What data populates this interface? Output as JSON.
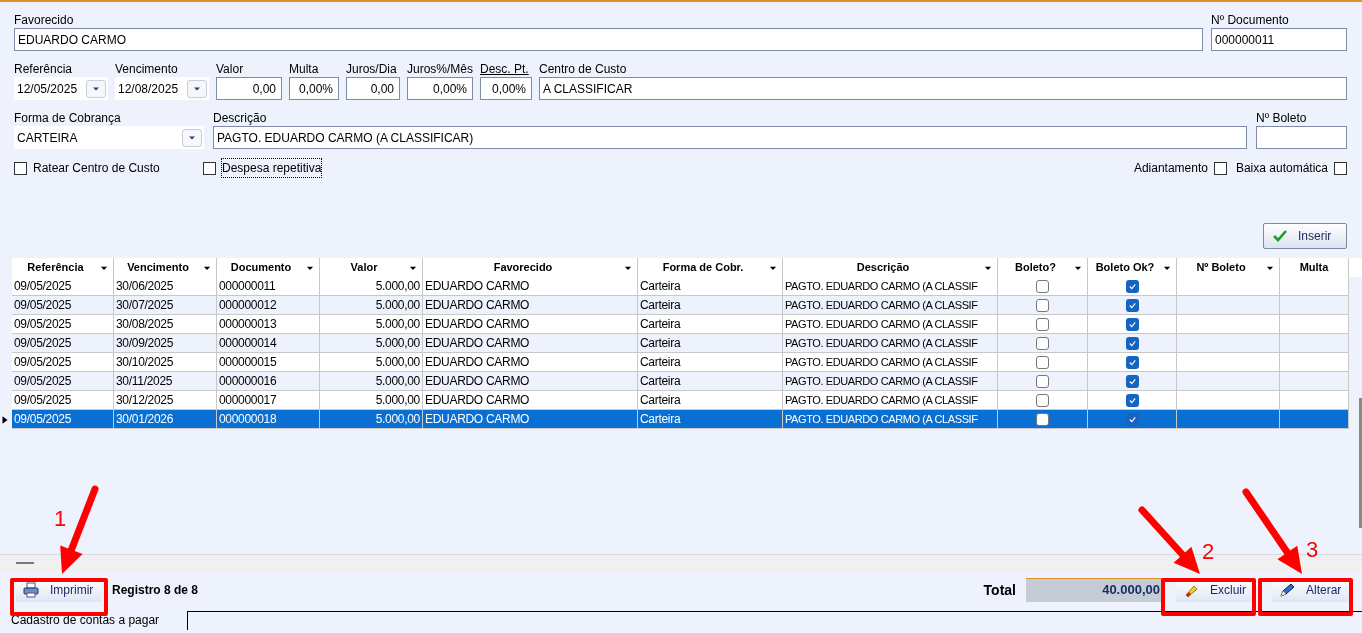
{
  "form": {
    "fields": [
      {
        "label": "Favorecido",
        "value": "EDUARDO CARMO",
        "kind": "text",
        "underlined": false
      },
      {
        "label": "Nº Documento",
        "value": "000000011",
        "kind": "text",
        "underlined": false
      },
      {
        "label": "Referência",
        "value": "12/05/2025",
        "kind": "combo",
        "underlined": false
      },
      {
        "label": "Vencimento",
        "value": "12/08/2025",
        "kind": "combo",
        "underlined": false
      },
      {
        "label": "Valor",
        "value": "0,00",
        "kind": "number",
        "underlined": false
      },
      {
        "label": "Multa",
        "value": "0,00%",
        "kind": "number",
        "underlined": false
      },
      {
        "label": "Juros/Dia",
        "value": "0,00",
        "kind": "number",
        "underlined": false
      },
      {
        "label": "Juros%/Mês",
        "value": "0,00%",
        "kind": "number",
        "underlined": false
      },
      {
        "label": "Desc. Pt.",
        "value": "0,00%",
        "kind": "number",
        "underlined": true
      },
      {
        "label": "Centro de Custo",
        "value": "A CLASSIFICAR",
        "kind": "text",
        "underlined": false
      },
      {
        "label": "Forma de Cobrança",
        "value": "CARTEIRA",
        "kind": "combo",
        "underlined": false
      },
      {
        "label": "Descrição",
        "value": "PAGTO. EDUARDO CARMO (A CLASSIFICAR)",
        "kind": "text",
        "underlined": false
      },
      {
        "label": "Nº Boleto",
        "kind": "text",
        "underlined": false
      }
    ],
    "checkboxes_left": [
      {
        "label": "Ratear Centro de Custo",
        "checked": false,
        "focused": false
      },
      {
        "label": "Despesa repetitiva",
        "checked": false,
        "focused": true
      }
    ],
    "checkboxes_right": [
      {
        "label": "Adiantamento",
        "checked": false
      },
      {
        "label": "Baixa automática",
        "checked": false
      }
    ]
  },
  "insert_button": "Inserir",
  "grid": {
    "columns": [
      {
        "label": "Referência",
        "filter": true
      },
      {
        "label": "Vencimento",
        "filter": true
      },
      {
        "label": "Documento",
        "filter": true
      },
      {
        "label": "Valor",
        "filter": true
      },
      {
        "label": "Favorecido",
        "filter": true
      },
      {
        "label": "Forma de Cobr.",
        "filter": true
      },
      {
        "label": "Descrição",
        "filter": true
      },
      {
        "label": "Boleto?",
        "filter": true
      },
      {
        "label": "Boleto Ok?",
        "filter": true
      },
      {
        "label": "Nº Boleto",
        "filter": true
      },
      {
        "label": "Multa",
        "filter": false
      }
    ],
    "rows": [
      {
        "cells": [
          "09/05/2025",
          "30/06/2025",
          "000000011",
          "5.000,00",
          "EDUARDO CARMO",
          "Carteira",
          "PAGTO. EDUARDO CARMO (A CLASSIF"
        ],
        "boleto": false,
        "boleto_ok": true,
        "selected": false
      },
      {
        "cells": [
          "09/05/2025",
          "30/07/2025",
          "000000012",
          "5.000,00",
          "EDUARDO CARMO",
          "Carteira",
          "PAGTO. EDUARDO CARMO (A CLASSIF"
        ],
        "boleto": false,
        "boleto_ok": true,
        "selected": false
      },
      {
        "cells": [
          "09/05/2025",
          "30/08/2025",
          "000000013",
          "5.000,00",
          "EDUARDO CARMO",
          "Carteira",
          "PAGTO. EDUARDO CARMO (A CLASSIF"
        ],
        "boleto": false,
        "boleto_ok": true,
        "selected": false
      },
      {
        "cells": [
          "09/05/2025",
          "30/09/2025",
          "000000014",
          "5.000,00",
          "EDUARDO CARMO",
          "Carteira",
          "PAGTO. EDUARDO CARMO (A CLASSIF"
        ],
        "boleto": false,
        "boleto_ok": true,
        "selected": false
      },
      {
        "cells": [
          "09/05/2025",
          "30/10/2025",
          "000000015",
          "5.000,00",
          "EDUARDO CARMO",
          "Carteira",
          "PAGTO. EDUARDO CARMO (A CLASSIF"
        ],
        "boleto": false,
        "boleto_ok": true,
        "selected": false
      },
      {
        "cells": [
          "09/05/2025",
          "30/11/2025",
          "000000016",
          "5.000,00",
          "EDUARDO CARMO",
          "Carteira",
          "PAGTO. EDUARDO CARMO (A CLASSIF"
        ],
        "boleto": false,
        "boleto_ok": true,
        "selected": false
      },
      {
        "cells": [
          "09/05/2025",
          "30/12/2025",
          "000000017",
          "5.000,00",
          "EDUARDO CARMO",
          "Carteira",
          "PAGTO. EDUARDO CARMO (A CLASSIF"
        ],
        "boleto": false,
        "boleto_ok": true,
        "selected": false
      },
      {
        "cells": [
          "09/05/2025",
          "30/01/2026",
          "000000018",
          "5.000,00",
          "EDUARDO CARMO",
          "Carteira",
          "PAGTO. EDUARDO CARMO (A CLASSIF"
        ],
        "boleto": false,
        "boleto_ok": true,
        "selected": true
      }
    ]
  },
  "footer": {
    "print_button": "Imprimir",
    "record": "Registro 8 de 8",
    "total_label": "Total",
    "total_value": "40.000,00",
    "delete_button": "Excluir",
    "edit_button": "Alterar"
  },
  "status_tab": "Cadastro de contas a pagar",
  "annotations": [
    {
      "label": "1"
    },
    {
      "label": "2"
    },
    {
      "label": "3"
    }
  ]
}
